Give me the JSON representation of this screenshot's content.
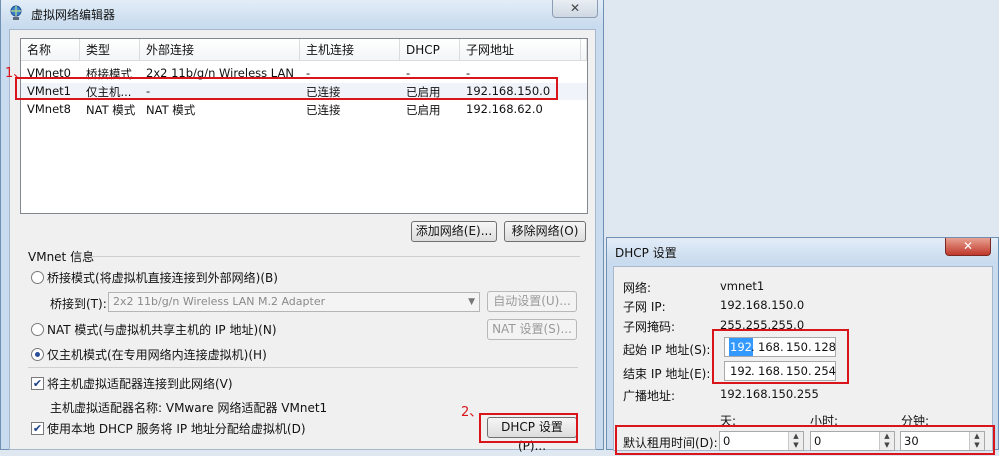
{
  "main_window": {
    "title": "虚拟网络编辑器",
    "close_label": "✕",
    "columns": [
      "名称",
      "类型",
      "外部连接",
      "主机连接",
      "DHCP",
      "子网地址"
    ],
    "rows": [
      {
        "name": "VMnet0",
        "type": "桥接模式",
        "external": "2x2 11b/g/n Wireless LAN M...",
        "host": "-",
        "dhcp": "-",
        "subnet": "-"
      },
      {
        "name": "VMnet1",
        "type": "仅主机...",
        "external": "-",
        "host": "已连接",
        "dhcp": "已启用",
        "subnet": "192.168.150.0"
      },
      {
        "name": "VMnet8",
        "type": "NAT 模式",
        "external": "NAT 模式",
        "host": "已连接",
        "dhcp": "已启用",
        "subnet": "192.168.62.0"
      }
    ],
    "add_network": "添加网络(E)...",
    "remove_network": "移除网络(O)",
    "vmnet_info_label": "VMnet 信息",
    "bridge_mode": "桥接模式(将虚拟机直接连接到外部网络)(B)",
    "bridge_to_label": "桥接到(T):",
    "bridge_adapter": "2x2 11b/g/n Wireless LAN M.2 Adapter",
    "auto_settings": "自动设置(U)...",
    "nat_mode": "NAT 模式(与虚拟机共享主机的 IP 地址)(N)",
    "nat_settings": "NAT 设置(S)...",
    "host_only_mode": "仅主机模式(在专用网络内连接虚拟机)(H)",
    "connect_adapter": "将主机虚拟适配器连接到此网络(V)",
    "adapter_name": "主机虚拟适配器名称: VMware 网络适配器 VMnet1",
    "use_dhcp": "使用本地 DHCP 服务将 IP 地址分配给虚拟机(D)",
    "dhcp_settings": "DHCP 设置(P)...",
    "annotation_1": "1、",
    "annotation_2": "2、"
  },
  "dhcp_window": {
    "title": "DHCP 设置",
    "close_label": "✕",
    "network_label": "网络:",
    "network_value": "vmnet1",
    "subnet_ip_label": "子网 IP:",
    "subnet_ip_value": "192.168.150.0",
    "mask_label": "子网掩码:",
    "mask_value": "255.255.255.0",
    "start_ip_label": "起始 IP 地址(S):",
    "start_ip": [
      "192",
      "168",
      "150",
      "128"
    ],
    "end_ip_label": "结束 IP 地址(E):",
    "end_ip": [
      "192",
      "168",
      "150",
      "254"
    ],
    "broadcast_label": "广播地址:",
    "broadcast_value": "192.168.150.255",
    "day_label": "天:",
    "hour_label": "小时:",
    "minute_label": "分钟:",
    "lease_label": "默认租用时间(D):",
    "lease_days": "0",
    "lease_hours": "0",
    "lease_minutes": "30"
  }
}
